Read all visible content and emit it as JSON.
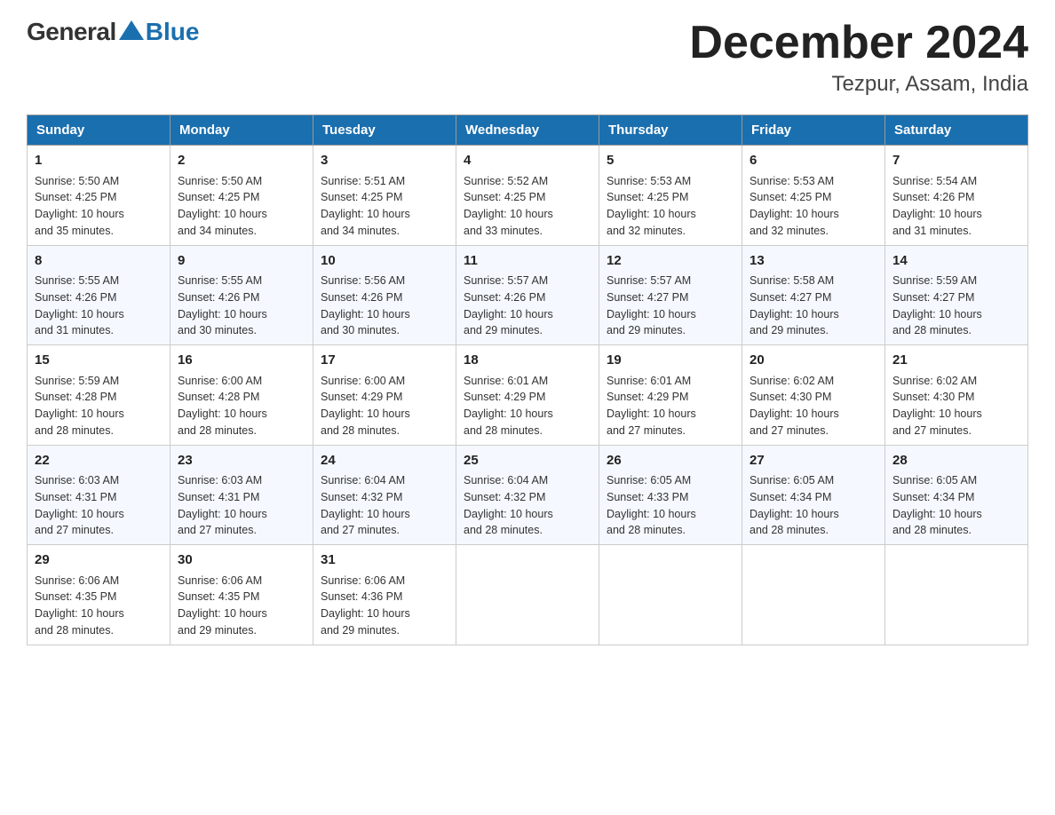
{
  "logo": {
    "general": "General",
    "blue": "Blue",
    "triangle_color": "#1a6faf"
  },
  "title": "December 2024",
  "subtitle": "Tezpur, Assam, India",
  "header_row": [
    "Sunday",
    "Monday",
    "Tuesday",
    "Wednesday",
    "Thursday",
    "Friday",
    "Saturday"
  ],
  "weeks": [
    [
      {
        "day": "1",
        "sunrise": "5:50 AM",
        "sunset": "4:25 PM",
        "daylight": "10 hours and 35 minutes."
      },
      {
        "day": "2",
        "sunrise": "5:50 AM",
        "sunset": "4:25 PM",
        "daylight": "10 hours and 34 minutes."
      },
      {
        "day": "3",
        "sunrise": "5:51 AM",
        "sunset": "4:25 PM",
        "daylight": "10 hours and 34 minutes."
      },
      {
        "day": "4",
        "sunrise": "5:52 AM",
        "sunset": "4:25 PM",
        "daylight": "10 hours and 33 minutes."
      },
      {
        "day": "5",
        "sunrise": "5:53 AM",
        "sunset": "4:25 PM",
        "daylight": "10 hours and 32 minutes."
      },
      {
        "day": "6",
        "sunrise": "5:53 AM",
        "sunset": "4:25 PM",
        "daylight": "10 hours and 32 minutes."
      },
      {
        "day": "7",
        "sunrise": "5:54 AM",
        "sunset": "4:26 PM",
        "daylight": "10 hours and 31 minutes."
      }
    ],
    [
      {
        "day": "8",
        "sunrise": "5:55 AM",
        "sunset": "4:26 PM",
        "daylight": "10 hours and 31 minutes."
      },
      {
        "day": "9",
        "sunrise": "5:55 AM",
        "sunset": "4:26 PM",
        "daylight": "10 hours and 30 minutes."
      },
      {
        "day": "10",
        "sunrise": "5:56 AM",
        "sunset": "4:26 PM",
        "daylight": "10 hours and 30 minutes."
      },
      {
        "day": "11",
        "sunrise": "5:57 AM",
        "sunset": "4:26 PM",
        "daylight": "10 hours and 29 minutes."
      },
      {
        "day": "12",
        "sunrise": "5:57 AM",
        "sunset": "4:27 PM",
        "daylight": "10 hours and 29 minutes."
      },
      {
        "day": "13",
        "sunrise": "5:58 AM",
        "sunset": "4:27 PM",
        "daylight": "10 hours and 29 minutes."
      },
      {
        "day": "14",
        "sunrise": "5:59 AM",
        "sunset": "4:27 PM",
        "daylight": "10 hours and 28 minutes."
      }
    ],
    [
      {
        "day": "15",
        "sunrise": "5:59 AM",
        "sunset": "4:28 PM",
        "daylight": "10 hours and 28 minutes."
      },
      {
        "day": "16",
        "sunrise": "6:00 AM",
        "sunset": "4:28 PM",
        "daylight": "10 hours and 28 minutes."
      },
      {
        "day": "17",
        "sunrise": "6:00 AM",
        "sunset": "4:29 PM",
        "daylight": "10 hours and 28 minutes."
      },
      {
        "day": "18",
        "sunrise": "6:01 AM",
        "sunset": "4:29 PM",
        "daylight": "10 hours and 28 minutes."
      },
      {
        "day": "19",
        "sunrise": "6:01 AM",
        "sunset": "4:29 PM",
        "daylight": "10 hours and 27 minutes."
      },
      {
        "day": "20",
        "sunrise": "6:02 AM",
        "sunset": "4:30 PM",
        "daylight": "10 hours and 27 minutes."
      },
      {
        "day": "21",
        "sunrise": "6:02 AM",
        "sunset": "4:30 PM",
        "daylight": "10 hours and 27 minutes."
      }
    ],
    [
      {
        "day": "22",
        "sunrise": "6:03 AM",
        "sunset": "4:31 PM",
        "daylight": "10 hours and 27 minutes."
      },
      {
        "day": "23",
        "sunrise": "6:03 AM",
        "sunset": "4:31 PM",
        "daylight": "10 hours and 27 minutes."
      },
      {
        "day": "24",
        "sunrise": "6:04 AM",
        "sunset": "4:32 PM",
        "daylight": "10 hours and 27 minutes."
      },
      {
        "day": "25",
        "sunrise": "6:04 AM",
        "sunset": "4:32 PM",
        "daylight": "10 hours and 28 minutes."
      },
      {
        "day": "26",
        "sunrise": "6:05 AM",
        "sunset": "4:33 PM",
        "daylight": "10 hours and 28 minutes."
      },
      {
        "day": "27",
        "sunrise": "6:05 AM",
        "sunset": "4:34 PM",
        "daylight": "10 hours and 28 minutes."
      },
      {
        "day": "28",
        "sunrise": "6:05 AM",
        "sunset": "4:34 PM",
        "daylight": "10 hours and 28 minutes."
      }
    ],
    [
      {
        "day": "29",
        "sunrise": "6:06 AM",
        "sunset": "4:35 PM",
        "daylight": "10 hours and 28 minutes."
      },
      {
        "day": "30",
        "sunrise": "6:06 AM",
        "sunset": "4:35 PM",
        "daylight": "10 hours and 29 minutes."
      },
      {
        "day": "31",
        "sunrise": "6:06 AM",
        "sunset": "4:36 PM",
        "daylight": "10 hours and 29 minutes."
      },
      null,
      null,
      null,
      null
    ]
  ],
  "labels": {
    "sunrise": "Sunrise:",
    "sunset": "Sunset:",
    "daylight": "Daylight:"
  }
}
